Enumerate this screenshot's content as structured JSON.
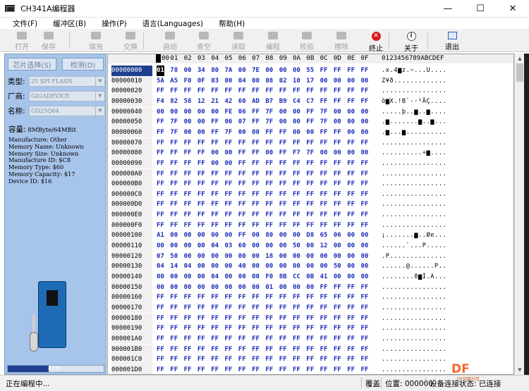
{
  "window": {
    "title": "CH341A编程器",
    "controls": [
      "—",
      "☐",
      "✕"
    ]
  },
  "menu": [
    "文件(F)",
    "缓冲区(B)",
    "操作(P)",
    "语言(Languages)",
    "帮助(H)"
  ],
  "toolbar": [
    {
      "label": "打开",
      "icon": "open-icon",
      "enabled": false
    },
    {
      "label": "保存",
      "icon": "save-icon",
      "enabled": false
    },
    {
      "label": "填充",
      "icon": "fill-icon",
      "enabled": false
    },
    {
      "label": "交换",
      "icon": "swap-icon",
      "enabled": false
    },
    {
      "label": "自动",
      "icon": "auto-icon",
      "enabled": false
    },
    {
      "label": "查空",
      "icon": "blank-check-icon",
      "enabled": false
    },
    {
      "label": "读取",
      "icon": "read-icon",
      "enabled": false
    },
    {
      "label": "编程",
      "icon": "program-icon",
      "enabled": false
    },
    {
      "label": "校验",
      "icon": "verify-icon",
      "enabled": false
    },
    {
      "label": "擦除",
      "icon": "erase-icon",
      "enabled": false
    },
    {
      "label": "终止",
      "icon": "stop-icon",
      "enabled": true
    },
    {
      "label": "关于",
      "icon": "about-icon",
      "enabled": true
    },
    {
      "label": "退出",
      "icon": "exit-icon",
      "enabled": true
    }
  ],
  "left": {
    "chip_select": "芯片选择(S)",
    "detect": "检测(D)",
    "type_label": "类型:",
    "type_value": "25 SPI FLASH",
    "vendor_label": "厂商:",
    "vendor_value": "GIGADEVICE",
    "name_label": "名称:",
    "name_value": "GD25Q64",
    "capacity_label": "容量:",
    "capacity_value": "8MByte/64MBit",
    "info": [
      "Manufacture: Other",
      "Memory Name: Unknown",
      "Memory Size: Unknown",
      "Manufacture ID: $C8",
      "Memory Type: $60",
      "Memory Capacity: $17",
      "Device ID: $16"
    ],
    "progress_text": "43%",
    "progress_value": 0.43
  },
  "hex": {
    "header_corner": "",
    "columns": [
      "00",
      "01",
      "02",
      "03",
      "04",
      "05",
      "06",
      "07",
      "08",
      "09",
      "0A",
      "0B",
      "0C",
      "0D",
      "0E",
      "0F"
    ],
    "ascii_header": "0123456789ABCDEF",
    "rows": [
      {
        "addr": "00000000",
        "bytes": "01 78 00 34 80 7A 00 7E 00 00 00 55 FF FF FF FF",
        "ascii": ".x.4▆z.~...U...."
      },
      {
        "addr": "00000010",
        "bytes": "5A A5 F0 0F 03 00 04 00 08 02 10 17 00 00 00 00",
        "ascii": "Z¥ð............."
      },
      {
        "addr": "00000020",
        "bytes": "FF FF FF FF FF FF FF FF FF FF FF FF FF FF FF FF",
        "ascii": "................"
      },
      {
        "addr": "00000030",
        "bytes": "F4 82 58 12 21 42 60 AD B7 B9 C4 C7 FF FF FF FF",
        "ascii": "ô▆X.!B`-·¹ÄÇ...."
      },
      {
        "addr": "00000040",
        "bytes": "00 00 00 00 00 FE 06 FF 7F 00 00 FF 7F 00 00 00",
        "ascii": ".....þ..▆..▆...."
      },
      {
        "addr": "00000050",
        "bytes": "FF 7F 00 00 FF 06 07 FF 7F 00 00 FF 7F 00 00 00",
        "ascii": ".▆.......▆..▆..."
      },
      {
        "addr": "00000060",
        "bytes": "FF 7F 00 00 FF 7F 00 00 FF FF 00 00 FF FF 00 00",
        "ascii": ".▆...▆.........."
      },
      {
        "addr": "00000070",
        "bytes": "FF FF FF FF FF FF FF FF FF FF FF FF FF FF FF FF",
        "ascii": "................"
      },
      {
        "addr": "00000080",
        "bytes": "FF FF FF FF 00 00 FF FF 00 FF F7 7F 00 00 00 00",
        "ascii": "..........÷▆...."
      },
      {
        "addr": "00000090",
        "bytes": "FF FF FF FF 00 00 FF FF FF FF FF FF FF FF FF FF",
        "ascii": "................"
      },
      {
        "addr": "000000A0",
        "bytes": "FF FF FF FF FF FF FF FF FF FF FF FF FF FF FF FF",
        "ascii": "................"
      },
      {
        "addr": "000000B0",
        "bytes": "FF FF FF FF FF FF FF FF FF FF FF FF FF FF FF FF",
        "ascii": "................"
      },
      {
        "addr": "000000C0",
        "bytes": "FF FF FF FF FF FF FF FF FF FF FF FF FF FF FF FF",
        "ascii": "................"
      },
      {
        "addr": "000000D0",
        "bytes": "FF FF FF FF FF FF FF FF FF FF FF FF FF FF FF FF",
        "ascii": "................"
      },
      {
        "addr": "000000E0",
        "bytes": "FF FF FF FF FF FF FF FF FF FF FF FF FF FF FF FF",
        "ascii": "................"
      },
      {
        "addr": "000000F0",
        "bytes": "FF FF FF FF FF FF FF FF FF FF FF FF FF FF FF FF",
        "ascii": "................"
      },
      {
        "addr": "00000100",
        "bytes": "A1 00 00 00 00 00 FF 00 80 00 00 D8 65 06 00 00",
        "ascii": "¡.......▆..Øe..."
      },
      {
        "addr": "00000110",
        "bytes": "00 00 00 00 04 03 60 00 00 00 50 00 12 00 00 00",
        "ascii": "......`...P....."
      },
      {
        "addr": "00000120",
        "bytes": "07 50 00 00 00 00 00 00 18 00 00 00 00 00 00 00",
        "ascii": ".P.............."
      },
      {
        "addr": "00000130",
        "bytes": "04 14 04 00 00 00 40 00 00 00 00 00 00 50 00 00",
        "ascii": "......@......P.."
      },
      {
        "addr": "00000140",
        "bytes": "00 00 00 00 04 00 00 00 F0 8B CC 0B 41 00 00 00",
        "ascii": "........ð▆Ì.A..."
      },
      {
        "addr": "00000150",
        "bytes": "00 00 00 00 00 00 00 00 01 00 00 00 FF FF FF FF",
        "ascii": "................"
      },
      {
        "addr": "00000160",
        "bytes": "FF FF FF FF FF FF FF FF FF FF FF FF FF FF FF FF",
        "ascii": "................"
      },
      {
        "addr": "00000170",
        "bytes": "FF FF FF FF FF FF FF FF FF FF FF FF FF FF FF FF",
        "ascii": "................"
      },
      {
        "addr": "00000180",
        "bytes": "FF FF FF FF FF FF FF FF FF FF FF FF FF FF FF FF",
        "ascii": "................"
      },
      {
        "addr": "00000190",
        "bytes": "FF FF FF FF FF FF FF FF FF FF FF FF FF FF FF FF",
        "ascii": "................"
      },
      {
        "addr": "000001A0",
        "bytes": "FF FF FF FF FF FF FF FF FF FF FF FF FF FF FF FF",
        "ascii": "................"
      },
      {
        "addr": "000001B0",
        "bytes": "FF FF FF FF FF FF FF FF FF FF FF FF FF FF FF FF",
        "ascii": "................"
      },
      {
        "addr": "000001C0",
        "bytes": "FF FF FF FF FF FF FF FF FF FF FF FF FF FF FF FF",
        "ascii": "................"
      },
      {
        "addr": "000001D0",
        "bytes": "FF FF FF FF FF FF FF FF FF FF FF FF FF FF FF FF",
        "ascii": "................"
      }
    ]
  },
  "status": {
    "left": "正在编程中...",
    "mode": "覆盖",
    "position": "位置: 000000",
    "device_status": "设备连接状态: 已连接"
  },
  "watermark": {
    "text": "DF",
    "sub": "DF创客社区"
  }
}
